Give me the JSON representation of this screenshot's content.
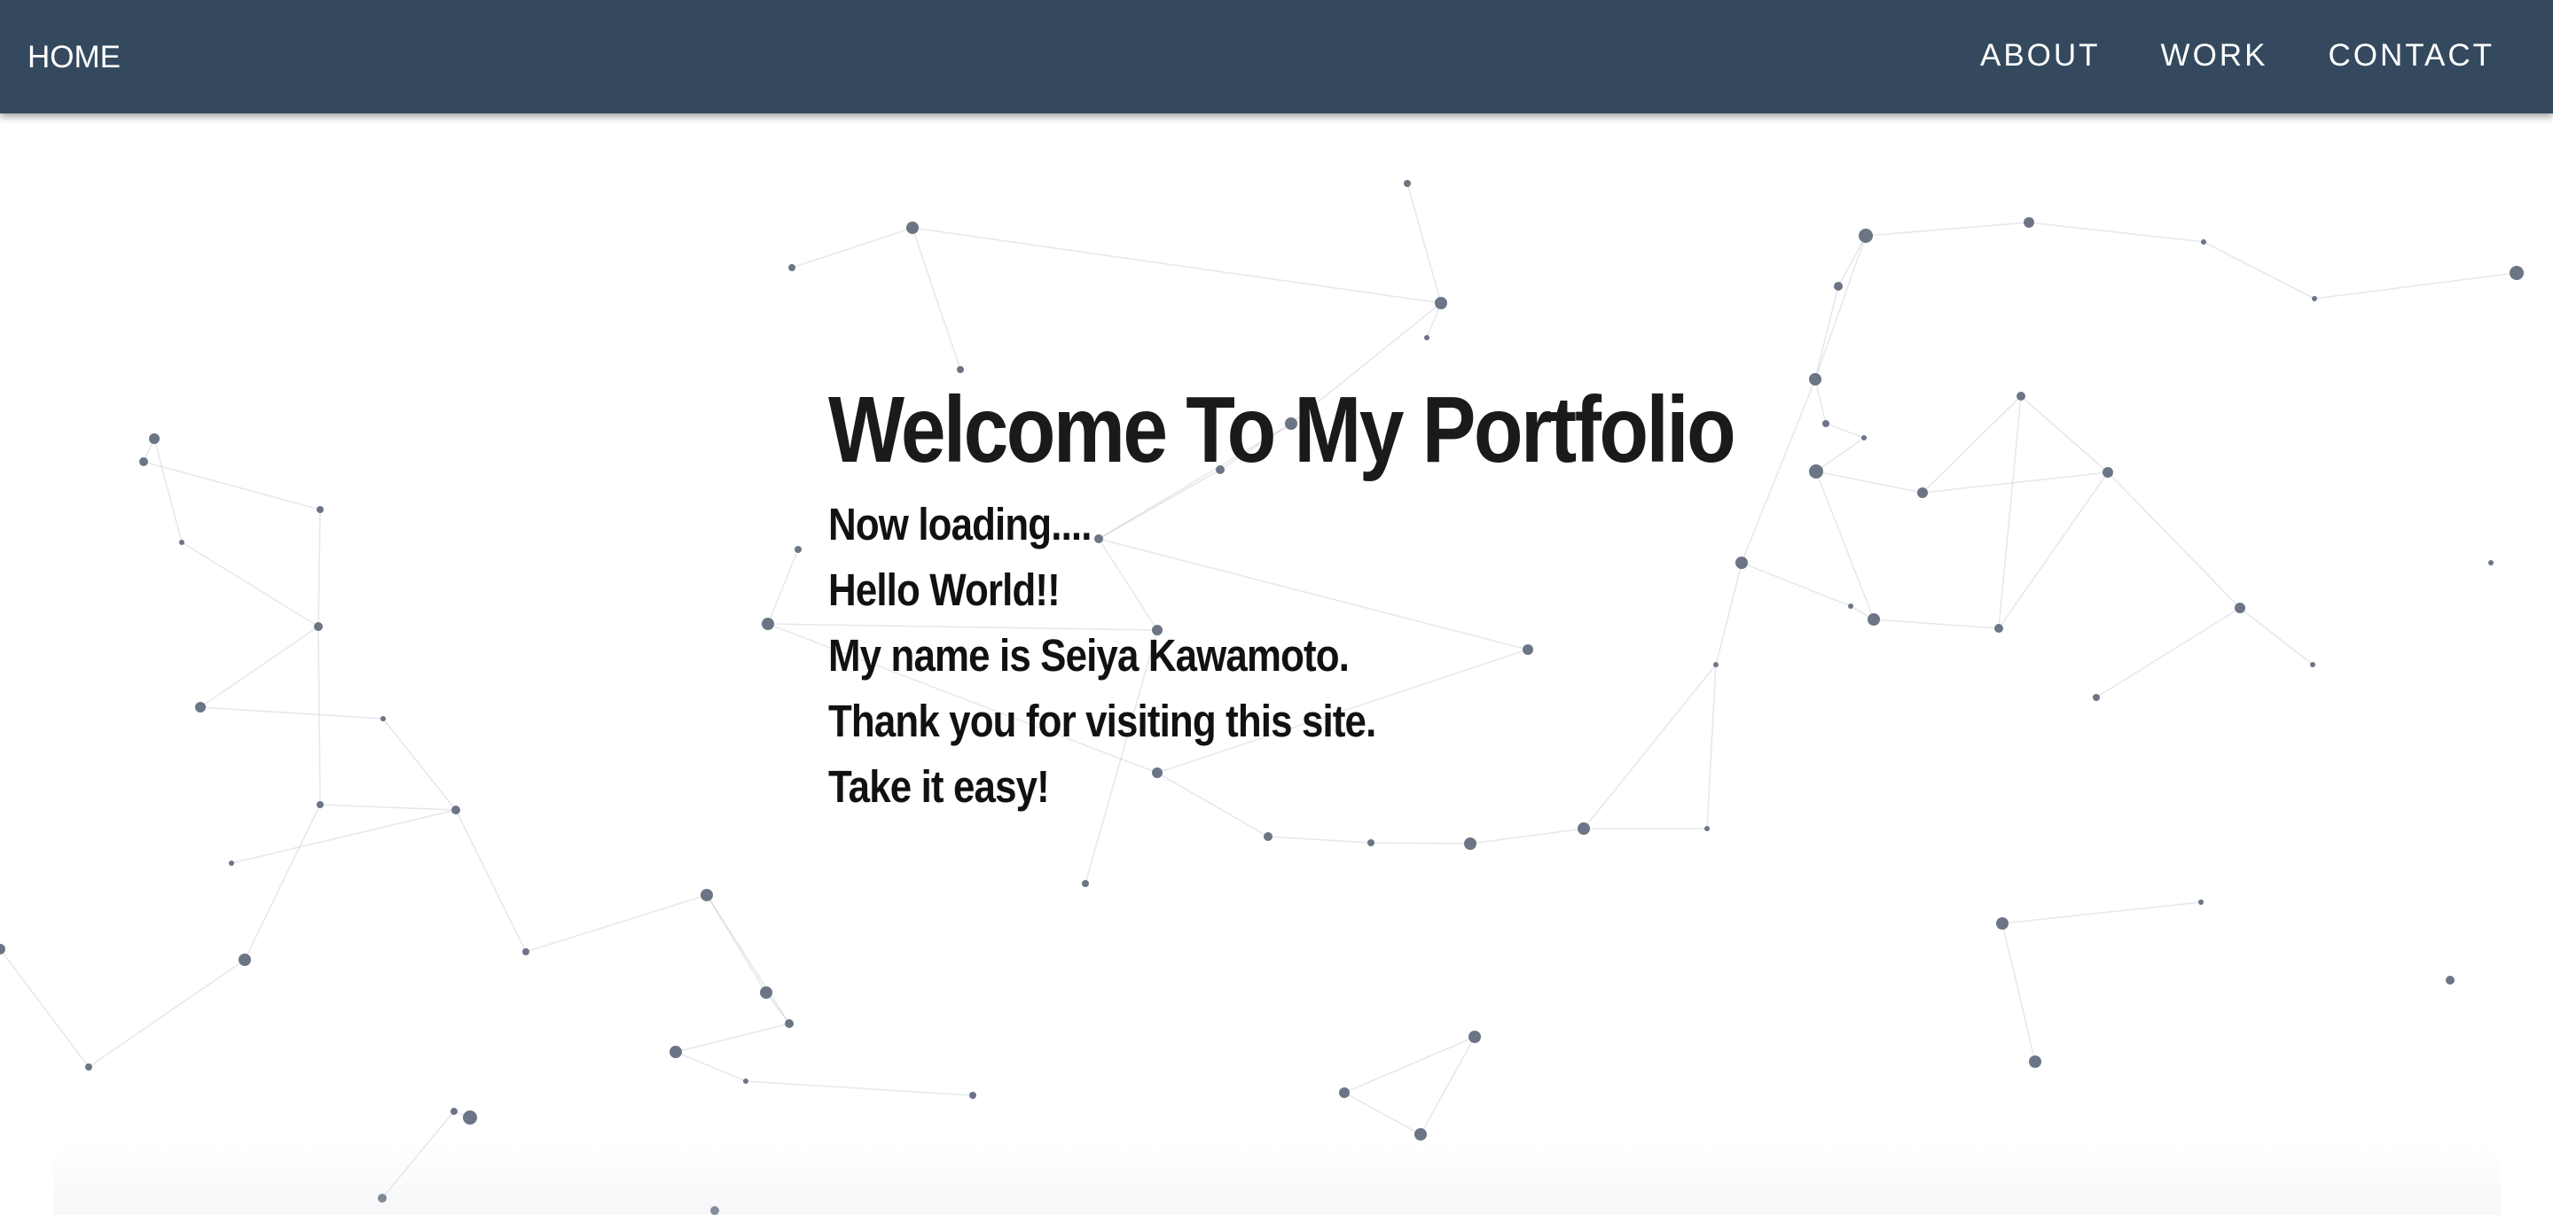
{
  "nav": {
    "home": "HOME",
    "links": [
      {
        "label": "ABOUT"
      },
      {
        "label": "WORK"
      },
      {
        "label": "CONTACT"
      }
    ]
  },
  "hero": {
    "title": "Welcome To My Portfolio",
    "lines": [
      "Now loading....",
      "Hello World!!",
      "My name is Seiya Kawamoto.",
      "Thank you for visiting this site.",
      "Take it easy!"
    ]
  },
  "colors": {
    "navbar": "#34495e",
    "nav_text": "#ffffff",
    "background": "#ffffff",
    "particle": "#6b7585",
    "particle_link": "#b7bfca",
    "hero_text": "#1a1a1a"
  },
  "background_effect": "particle-network"
}
